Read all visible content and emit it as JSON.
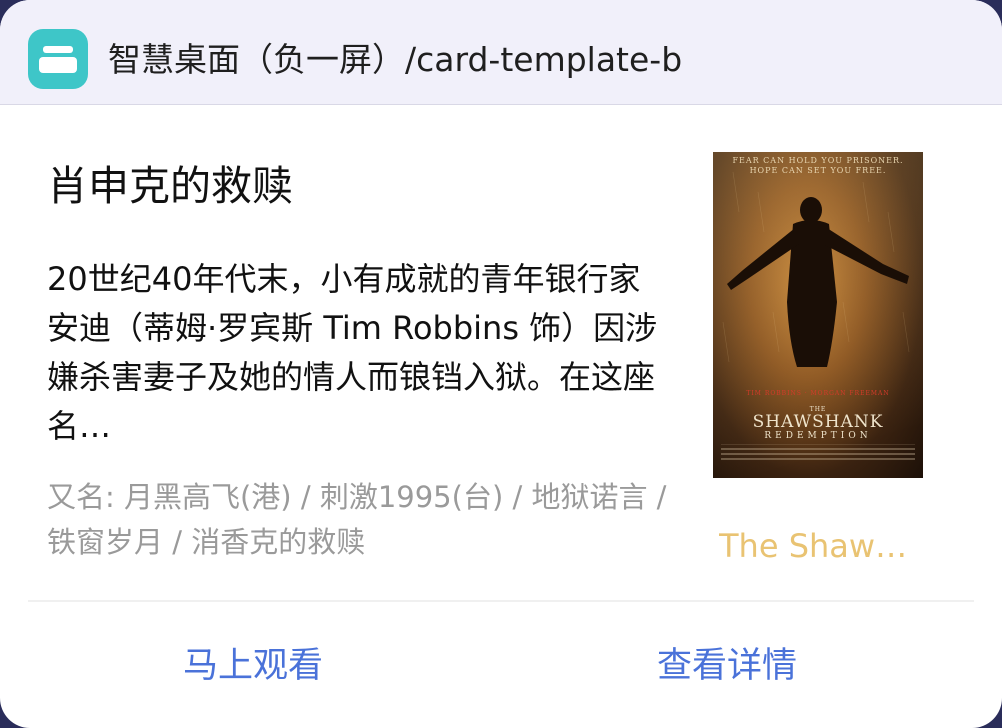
{
  "header": {
    "app_icon": "widget-stack-icon",
    "title": "智慧桌面（负一屏）/card-template-b"
  },
  "movie": {
    "title": "肖申克的救赎",
    "description": "20世纪40年代末，小有成就的青年银行家安迪（蒂姆·罗宾斯 Tim Robbins 饰）因涉嫌杀害妻子及她的情人而锒铛入狱。在这座名…",
    "aka": "又名: 月黑高飞(港) / 刺激1995(台) / 地狱诺言 / 铁窗岁月 / 消香克的救赎",
    "english_title": "The Shaw…",
    "poster": {
      "tagline_line1": "FEAR CAN HOLD YOU PRISONER.",
      "tagline_line2": "HOPE CAN SET YOU FREE.",
      "names": "TIM ROBBINS · MORGAN FREEMAN",
      "title_line1": "THE",
      "title_line2": "SHAWSHANK",
      "title_line3": "REDEMPTION"
    }
  },
  "actions": {
    "watch_now": "马上观看",
    "view_details": "查看详情"
  },
  "colors": {
    "header_bg": "#f1f0fa",
    "app_icon": "#3ec6c8",
    "action": "#4a72d9",
    "english_title": "#e9c372",
    "secondary_text": "#9a9a9a"
  }
}
